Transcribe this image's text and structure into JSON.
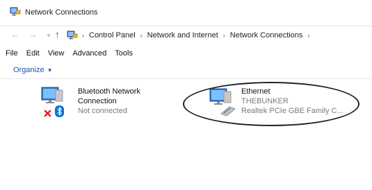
{
  "window": {
    "title": "Network Connections"
  },
  "address_bar": {
    "crumbs": [
      "Control Panel",
      "Network and Internet",
      "Network Connections"
    ]
  },
  "menu": {
    "items": [
      "File",
      "Edit",
      "View",
      "Advanced",
      "Tools"
    ]
  },
  "toolbar": {
    "organize_label": "Organize"
  },
  "connections": [
    {
      "name_line1": "Bluetooth Network",
      "name_line2": "Connection",
      "status": "Not connected"
    },
    {
      "name": "Ethernet",
      "network": "THEBUNKER",
      "adapter": "Realtek PCIe GBE Family C..."
    }
  ],
  "colors": {
    "link_blue": "#1b5aa6",
    "status_gray": "#7a7a7a",
    "error_red": "#e81123",
    "bluetooth_blue": "#0a6fd6"
  }
}
